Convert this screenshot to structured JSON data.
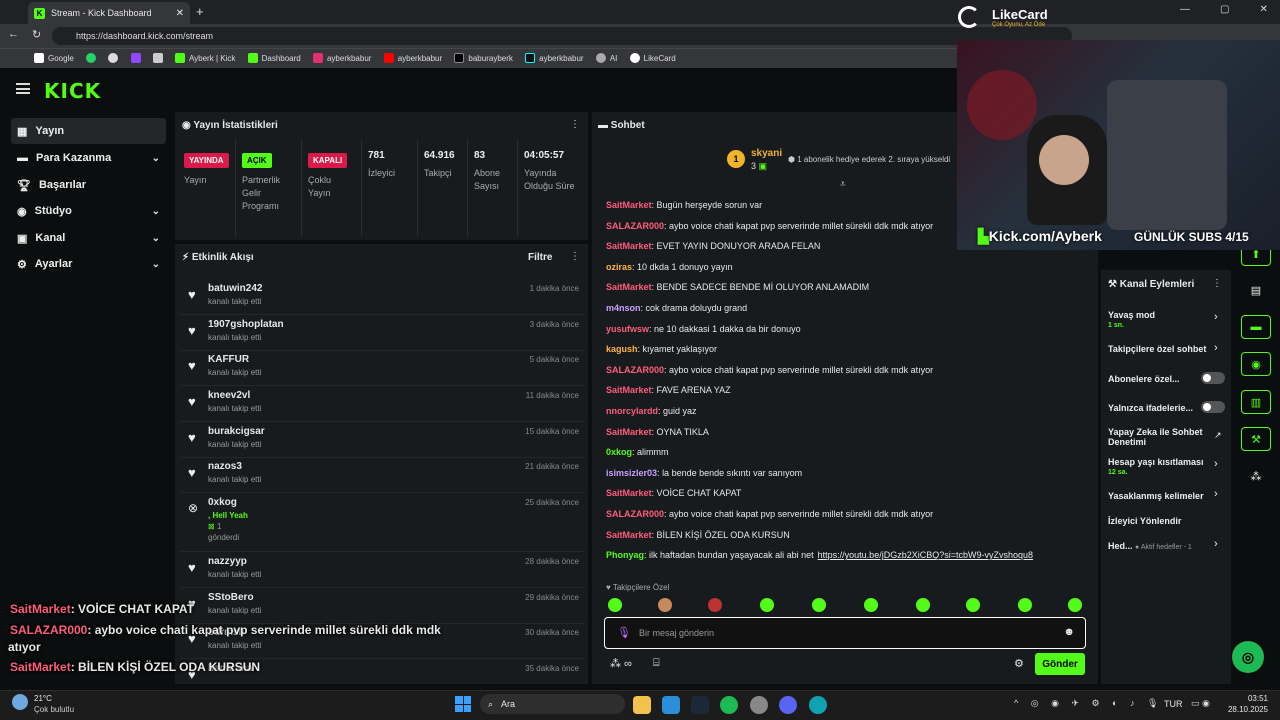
{
  "browser": {
    "tab_title": "Stream - Kick Dashboard",
    "url": "https://dashboard.kick.com/stream",
    "bookmarks": [
      "Google",
      "Ayberk | Kick",
      "Dashboard",
      "ayberkbabur",
      "ayberkbabur",
      "baburayberk",
      "ayberkbabur",
      "AI",
      "LikeCard"
    ]
  },
  "logo": "KICK",
  "sidebar": {
    "items": [
      {
        "label": "Yayın"
      },
      {
        "label": "Para Kazanma"
      },
      {
        "label": "Başarılar"
      },
      {
        "label": "Stüdyo"
      },
      {
        "label": "Kanal"
      },
      {
        "label": "Ayarlar"
      }
    ]
  },
  "stats": {
    "title": "Yayın İstatistikleri",
    "cells": [
      {
        "badge": "YAYINDA",
        "label": "Yayın"
      },
      {
        "badge": "AÇIK",
        "label": "Partnerlik Gelir Programı"
      },
      {
        "badge": "KAPALI",
        "label": "Çoklu Yayın"
      },
      {
        "value": "781",
        "label": "İzleyici"
      },
      {
        "value": "64.916",
        "label": "Takipçi"
      },
      {
        "value": "83",
        "label": "Abone Sayısı"
      },
      {
        "value": "04:05:57",
        "label": "Yayında Olduğu Süre"
      }
    ]
  },
  "feed": {
    "title": "Etkinlik Akışı",
    "filter": "Filtre",
    "rows": [
      {
        "name": "batuwin242",
        "sub": "kanalı takip etti",
        "time": "1 dakika önce"
      },
      {
        "name": "1907gshoplatan",
        "sub": "kanalı takip etti",
        "time": "3 dakika önce"
      },
      {
        "name": "KAFFUR",
        "sub": "kanalı takip etti",
        "time": "5 dakika önce"
      },
      {
        "name": "kneev2vl",
        "sub": "kanalı takip etti",
        "time": "11 dakika önce"
      },
      {
        "name": "burakcigsar",
        "sub": "kanalı takip etti",
        "time": "15 dakika önce"
      },
      {
        "name": "nazos3",
        "sub": "kanalı takip etti",
        "time": "21 dakika önce"
      },
      {
        "name": "0xkog",
        "sub": ", Hell Yeah",
        "extra": "1",
        "extra2": "gönderdi",
        "time": "25 dakika önce"
      },
      {
        "name": "nazzyyp",
        "sub": "kanalı takip etti",
        "time": "28 dakika önce"
      },
      {
        "name": "SStoBero",
        "sub": "kanalı takip etti",
        "time": "29 dakika önce"
      },
      {
        "name": "bdrmsb",
        "sub": "kanalı takip etti",
        "time": "30 dakika önce"
      },
      {
        "name": "hanarana",
        "sub": "",
        "time": "35 dakika önce"
      }
    ]
  },
  "chat": {
    "title": "Sohbet",
    "pinned_user": "skyani",
    "pinned_count": "3",
    "pinned_rank": "1",
    "pinned_text": "1 abonelik hediye ederek 2. sıraya yükseldi",
    "messages": [
      {
        "user": "SaitMarket",
        "text": "Bugün herşeyde sorun var",
        "color": "r"
      },
      {
        "user": "SALAZAR000",
        "text": "aybo voice chati kapat pvp serverinde millet sürekli ddk mdk atıyor",
        "color": "r"
      },
      {
        "user": "SaitMarket",
        "text": "EVET YAYIN DONUYOR ARADA FELAN",
        "color": "r"
      },
      {
        "user": "oziras",
        "text": "10 dkda 1 donuyo yayın",
        "color": "o"
      },
      {
        "user": "SaitMarket",
        "text": "BENDE SADECE BENDE Mİ OLUYOR ANLAMADIM",
        "color": "r"
      },
      {
        "user": "m4nson",
        "text": "cok drama doluydu grand",
        "color": "p"
      },
      {
        "user": "yusufwsw",
        "text": "ne 10 dakkasi 1 dakka da bir donuyo",
        "color": "r"
      },
      {
        "user": "kagush",
        "text": "kıyamet yaklaşıyor",
        "color": "o"
      },
      {
        "user": "SALAZAR000",
        "text": "aybo voice chati kapat pvp serverinde millet sürekli ddk mdk atıyor",
        "color": "r"
      },
      {
        "user": "SaitMarket",
        "text": "FAVE ARENA YAZ",
        "color": "r"
      },
      {
        "user": "nnorcylardd",
        "text": "guid yaz",
        "color": "r"
      },
      {
        "user": "SaitMarket",
        "text": "OYNA TIKLA",
        "color": "r"
      },
      {
        "user": "0xkog",
        "text": "alimmm",
        "color": "g"
      },
      {
        "user": "isimsizler03",
        "text": "la bende bende sıkıntı var sanıyom",
        "color": "p"
      },
      {
        "user": "SaitMarket",
        "text": "VOİCE CHAT KAPAT",
        "color": "r"
      },
      {
        "user": "SALAZAR000",
        "text": "aybo voice chati kapat pvp serverinde millet sürekli ddk mdk atıyor",
        "color": "r"
      },
      {
        "user": "SaitMarket",
        "text": "BİLEN KİŞİ ÖZEL ODA KURSUN",
        "color": "r"
      },
      {
        "user": "Phonyag",
        "text": "ilk haftadan bundan yaşayacak ali abi net",
        "link": "https://youtu.be/jDGzb2XiCBQ?si=tcbW9-vyZvshoqu8",
        "color": "g"
      }
    ],
    "followers_only": "Takipçilere Özel",
    "placeholder": "Bir mesaj gönderin",
    "send": "Gönder"
  },
  "actions": {
    "title": "Kanal Eylemleri",
    "items": [
      {
        "label": "Yavaş mod",
        "sub": "1 sn."
      },
      {
        "label": "Takipçilere özel sohbet"
      },
      {
        "label": "Abonelere özel..."
      },
      {
        "label": "Yalnızca ifadelerie..."
      },
      {
        "label": "Yapay Zeka ile Sohbet Denetimi"
      },
      {
        "label": "Hesap yaşı kısıtlaması",
        "sub": "12 sa."
      },
      {
        "label": "Yasaklanmış kelimeler"
      },
      {
        "label": "İzleyici Yönlendir"
      },
      {
        "label": "Hed...",
        "sub": "Aktif hedefler - 1"
      }
    ]
  },
  "overlay": {
    "brand": "LikeCard",
    "brand_sub": "Çok Oyunu, Az Öde",
    "channel": "Kick.com/Ayberk",
    "subs_goal": "GÜNLÜK SUBS 4/15",
    "chat_lines": [
      {
        "user": "SaitMarket",
        "text": ": VOİCE CHAT KAPAT"
      },
      {
        "user": "SALAZAR000",
        "text": ": aybo voice chati kapat pvp serverinde millet sürekli ddk mdk"
      },
      {
        "user": "",
        "text": "atıyor"
      },
      {
        "user": "SaitMarket",
        "text": ": BİLEN KİŞİ ÖZEL ODA KURSUN"
      }
    ]
  },
  "taskbar": {
    "weather_temp": "21°C",
    "weather_text": "Çok bulutlu",
    "search": "Ara",
    "lang": "TUR",
    "time": "03:51",
    "date": "28.10.2025"
  }
}
